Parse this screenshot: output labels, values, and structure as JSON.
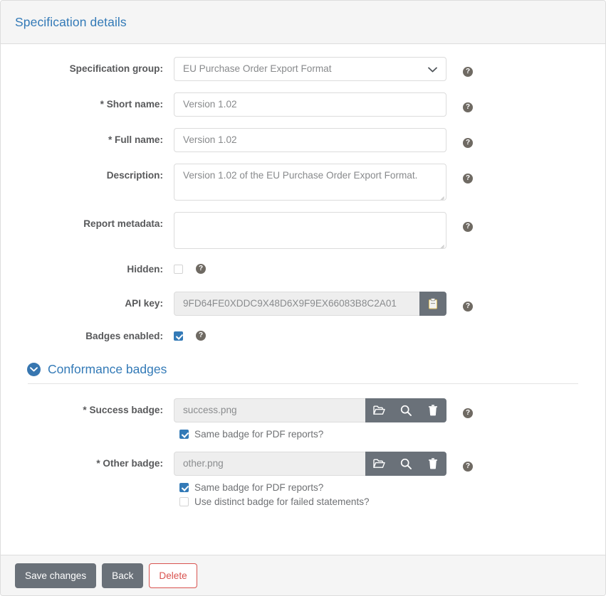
{
  "header": {
    "title": "Specification details"
  },
  "form": {
    "specification_group": {
      "label": "Specification group:",
      "value": "EU Purchase Order Export Format",
      "help": "?"
    },
    "short_name": {
      "label": "* Short name:",
      "value": "Version 1.02",
      "help": "?"
    },
    "full_name": {
      "label": "* Full name:",
      "value": "Version 1.02",
      "help": "?"
    },
    "description": {
      "label": "Description:",
      "value": "Version 1.02 of the EU Purchase Order Export Format.",
      "help": "?"
    },
    "report_metadata": {
      "label": "Report metadata:",
      "value": "",
      "help": "?"
    },
    "hidden": {
      "label": "Hidden:",
      "checked": false,
      "help": "?"
    },
    "api_key": {
      "label": "API key:",
      "value": "9FD64FE0XDDC9X48D6X9F9EX66083B8C2A01",
      "copy_icon": "clipboard-icon",
      "help": "?"
    },
    "badges_enabled": {
      "label": "Badges enabled:",
      "checked": true,
      "help": "?"
    }
  },
  "conformance_badges": {
    "title": "Conformance badges",
    "toggle_icon": "chevron-down-icon",
    "success_badge": {
      "label": "* Success badge:",
      "value": "success.png",
      "buttons": [
        "folder-open-icon",
        "search-icon",
        "trash-icon"
      ],
      "help": "?",
      "same_pdf": {
        "label": "Same badge for PDF reports?",
        "checked": true
      }
    },
    "other_badge": {
      "label": "* Other badge:",
      "value": "other.png",
      "buttons": [
        "folder-open-icon",
        "search-icon",
        "trash-icon"
      ],
      "help": "?",
      "same_pdf": {
        "label": "Same badge for PDF reports?",
        "checked": true
      },
      "distinct_failed": {
        "label": "Use distinct badge for failed statements?",
        "checked": false
      }
    }
  },
  "footer": {
    "save_label": "Save changes",
    "back_label": "Back",
    "delete_label": "Delete"
  },
  "colors": {
    "accent_blue": "#337ab7",
    "danger_red": "#d9534f",
    "button_gray": "#6a7179",
    "help_icon": "#6f6a63",
    "panel_gray": "#f5f5f5"
  }
}
